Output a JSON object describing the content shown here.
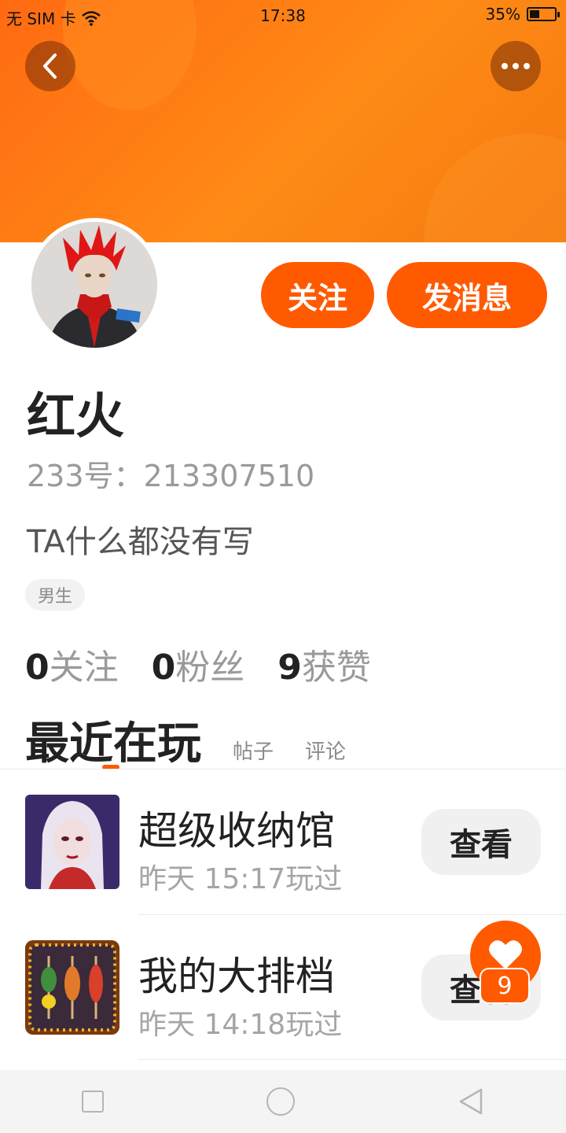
{
  "status_bar": {
    "carrier": "无 SIM 卡",
    "time": "17:38",
    "battery_percent": "35%",
    "battery_level": 0.35
  },
  "header": {
    "back_icon": "chevron-left-icon",
    "more_icon": "more-dots-icon"
  },
  "profile": {
    "name": "红火",
    "uid": "233号：213307510",
    "bio": "TA什么都没有写",
    "gender_tag": "男生",
    "follow_label": "关注",
    "message_label": "发消息"
  },
  "stats": [
    {
      "num": "0",
      "label": "关注"
    },
    {
      "num": "0",
      "label": "粉丝"
    },
    {
      "num": "9",
      "label": "获赞"
    }
  ],
  "tabs": {
    "active": "最近在玩",
    "posts": "帖子",
    "comments": "评论"
  },
  "games": [
    {
      "name": "超级收纳馆",
      "played": "昨天 15:17玩过",
      "button": "查看"
    },
    {
      "name": "我的大排档",
      "played": "昨天 14:18玩过",
      "button": "查看"
    }
  ],
  "like_fab": {
    "icon": "heart-icon",
    "count": "9"
  },
  "nav": {
    "recent": "square-icon",
    "home": "circle-icon",
    "back": "triangle-back-icon"
  },
  "colors": {
    "accent": "#ff5a00",
    "banner": "#ff7a12"
  }
}
